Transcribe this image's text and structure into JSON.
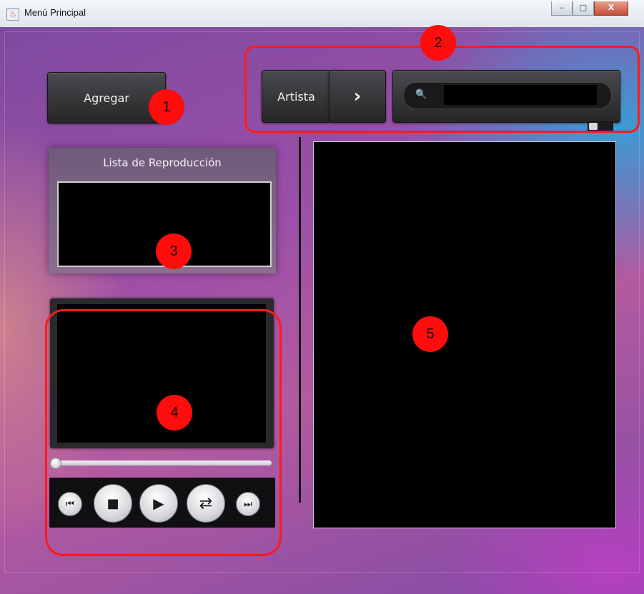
{
  "window": {
    "title": "Menú Principal",
    "controls": {
      "minimize": "–",
      "maximize": "□",
      "close": "X"
    }
  },
  "toolbar": {
    "add_label": "Agregar"
  },
  "search": {
    "filter_label": "Artista",
    "arrow_glyph": "›",
    "search_glyph": "🔍",
    "query_value": ""
  },
  "playlist": {
    "title": "Lista de Reproducción"
  },
  "player": {
    "seek_progress": 0,
    "buttons": {
      "prev": "⏮",
      "stop": "■",
      "play": "▶",
      "shuffle": "⇄",
      "next": "⏭"
    }
  },
  "annotations": [
    "1",
    "2",
    "3",
    "4",
    "5"
  ],
  "colors": {
    "annotation": "#ff0d0d",
    "panel_dark": "#262628",
    "screen": "#000000"
  }
}
